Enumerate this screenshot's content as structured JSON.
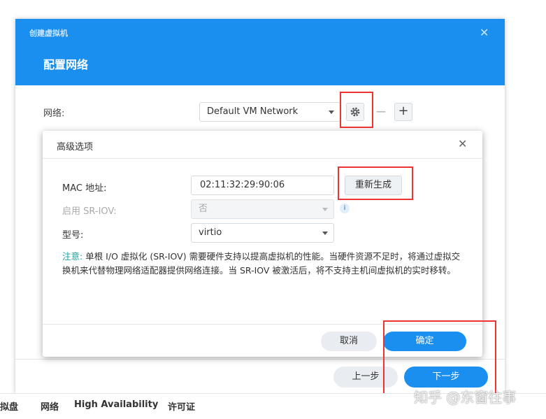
{
  "wizard": {
    "app_title": "创建虚拟机",
    "close_icon": "close-icon",
    "step_title": "配置网络",
    "network_label": "网络:",
    "network_value": "Default VM Network",
    "prev_label": "上一步",
    "next_label": "下一步"
  },
  "dialog": {
    "title": "高级选项",
    "mac_label": "MAC 地址:",
    "mac_value": "02:11:32:29:90:06",
    "regen_label": "重新生成",
    "sriov_label": "启用 SR-IOV:",
    "sriov_value": "否",
    "info_glyph": "i",
    "model_label": "型号:",
    "model_value": "virtio",
    "note_label": "注意:",
    "note_text": "单根 I/O 虚拟化 (SR-IOV) 需要硬件支持以提高虚拟机的性能。当硬件资源不足时，将通过虚拟交换机来代替物理网络适配器提供网络连接。当 SR-IOV 被激活后，将不支持主机间虚拟机的实时移转。",
    "cancel_label": "取消",
    "ok_label": "确定"
  },
  "tabs": {
    "vdisk": "虚拟盘",
    "network": "网络",
    "ha": "High Availability",
    "license": "许可证"
  },
  "watermark": "知乎 @东窗往事",
  "colors": {
    "header_blue": "#1a8ff0",
    "annotation_red": "#e33",
    "note_teal": "#1aa3a3"
  }
}
